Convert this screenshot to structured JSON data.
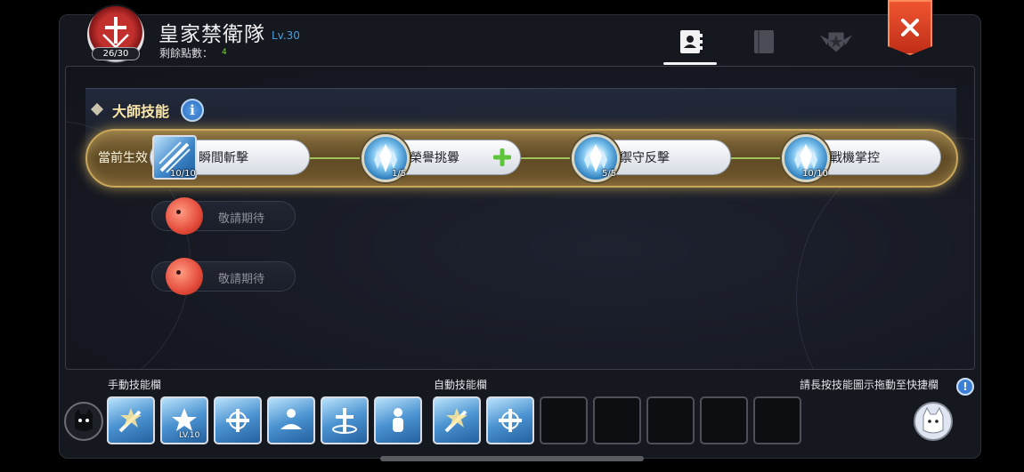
{
  "header": {
    "title": "皇家禁衛隊",
    "level": "Lv.30",
    "emblem_count": "26/30",
    "points_label": "剩餘點數：",
    "points_value": "4"
  },
  "tabs": [
    {
      "name": "contacts",
      "icon": "contact-book-icon",
      "active": true
    },
    {
      "name": "book",
      "icon": "book-icon",
      "active": false
    },
    {
      "name": "rank",
      "icon": "winged-star-badge-icon",
      "active": false
    }
  ],
  "master_skills": {
    "section_title": "大師技能",
    "active_label": "當前生效",
    "skills": [
      {
        "name": "瞬間斬擊",
        "count": "10/10",
        "icon": "sword-slash-icon"
      },
      {
        "name": "榮譽挑釁",
        "count": "1/5",
        "icon": "ice-crystal-icon",
        "upgradeable": true
      },
      {
        "name": "禦守反擊",
        "count": "5/5",
        "icon": "ice-crystal-icon"
      },
      {
        "name": "戰機掌控",
        "count": "10/10",
        "icon": "ice-crystal-icon"
      }
    ],
    "locked_rows": [
      {
        "text": "敬請期待"
      },
      {
        "text": "敬請期待"
      }
    ]
  },
  "skill_bars": {
    "manual_label": "手動技能欄",
    "auto_label": "自動技能欄",
    "hint": "請長按技能圖示拖動至快捷欄",
    "manual_slots": [
      {
        "icon": "sword-burst-icon"
      },
      {
        "icon": "shield-star-icon",
        "level": "LV.10"
      },
      {
        "icon": "cross-arrows-icon"
      },
      {
        "icon": "healing-figure-icon"
      },
      {
        "icon": "holy-cross-icon"
      },
      {
        "icon": "knight-figure-icon"
      }
    ],
    "auto_slots": [
      {
        "icon": "sword-burst-icon"
      },
      {
        "icon": "cross-arrows-icon"
      },
      {
        "icon": ""
      },
      {
        "icon": ""
      },
      {
        "icon": ""
      },
      {
        "icon": ""
      },
      {
        "icon": ""
      }
    ]
  },
  "colors": {
    "accent_gold": "#c9a85a",
    "close_red": "#e2452b",
    "level_blue": "#4a9ede",
    "points_green": "#7fd23a"
  }
}
